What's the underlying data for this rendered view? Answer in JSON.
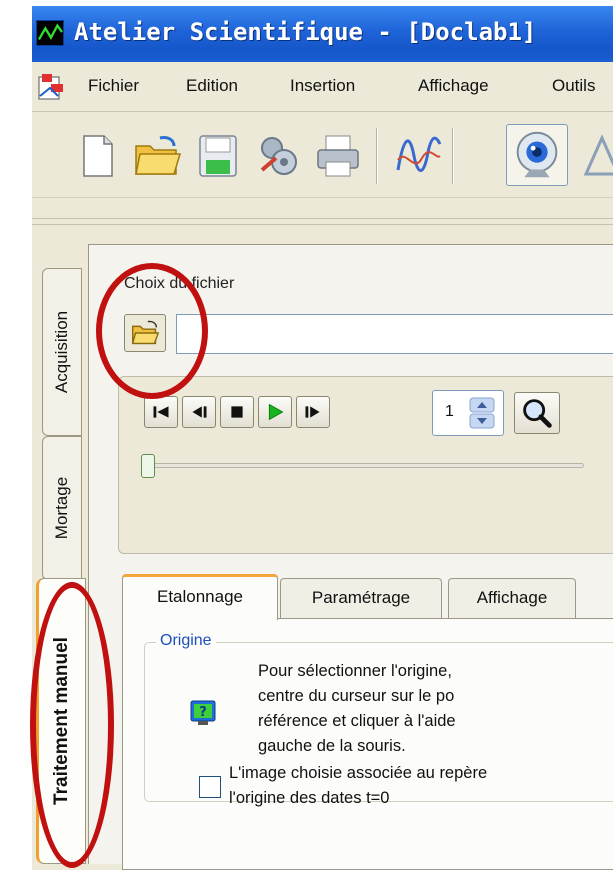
{
  "window": {
    "title": "Atelier Scientifique - [Doclab1]"
  },
  "menu": {
    "items": [
      "Fichier",
      "Edition",
      "Insertion",
      "Affichage",
      "Outils"
    ]
  },
  "toolbar": {
    "buttons": [
      "new-document-icon",
      "open-folder-icon",
      "save-icon",
      "tools-icon",
      "print-icon",
      "signal-curve-icon",
      "webcam-icon"
    ]
  },
  "side_tabs": {
    "acquisition": "Acquisition",
    "montage": "Mortage",
    "traitement": "Traitement manuel"
  },
  "file_chooser": {
    "label": "Choix du fichier",
    "value": ""
  },
  "player": {
    "frame_value": "1",
    "slider_position": 0
  },
  "tabs": {
    "items": [
      "Etalonnage",
      "Paramétrage",
      "Affichage"
    ],
    "active": "Etalonnage"
  },
  "origine": {
    "group_label": "Origine",
    "lines": [
      "Pour sélectionner l'origine,",
      "centre du curseur sur le po",
      "référence et cliquer à l'aide",
      "gauche de la souris."
    ],
    "checkbox_lines": [
      "L'image choisie associée au repère",
      "l'origine des dates t=0"
    ],
    "checkbox_checked": false
  },
  "colors": {
    "title_bar": "#1e63d8",
    "annotation": "#c01010",
    "active_tab_accent": "#f3a43c",
    "group_label": "#1e4fbb"
  }
}
